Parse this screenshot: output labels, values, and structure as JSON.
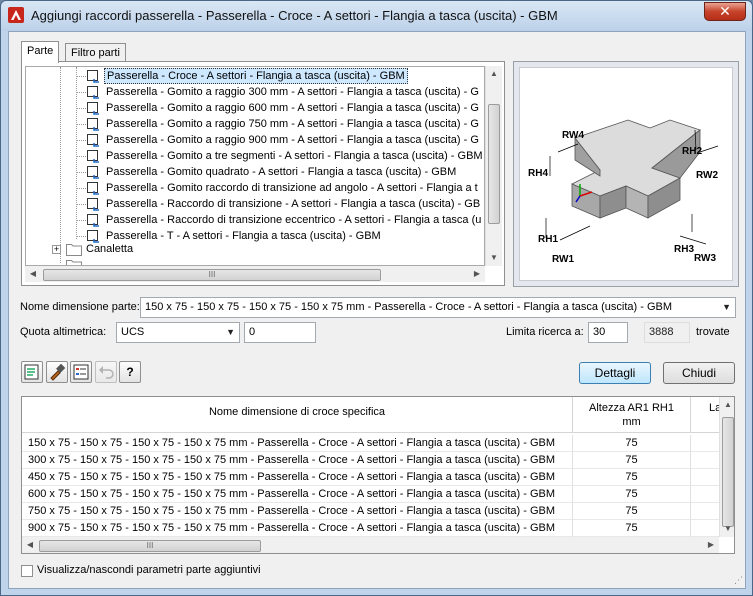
{
  "window": {
    "title": "Aggiungi raccordi passerella - Passerella - Croce - A settori - Flangia a tasca (uscita) - GBM",
    "close_label": "✕"
  },
  "tabs": [
    "Parte",
    "Filtro parti"
  ],
  "tree": {
    "items": [
      {
        "label": "Passerella - Croce - A settori - Flangia a tasca (uscita) - GBM",
        "selected": true
      },
      {
        "label": "Passerella - Gomito a raggio 300 mm - A settori - Flangia a tasca (uscita) - G"
      },
      {
        "label": "Passerella - Gomito a raggio 600 mm - A settori - Flangia a tasca (uscita) - G"
      },
      {
        "label": "Passerella - Gomito a raggio 750 mm - A settori - Flangia a tasca (uscita) - G"
      },
      {
        "label": "Passerella - Gomito a raggio 900 mm - A settori - Flangia a tasca (uscita) - G"
      },
      {
        "label": "Passerella - Gomito a tre segmenti - A settori - Flangia a tasca (uscita) - GBM"
      },
      {
        "label": "Passerella - Gomito quadrato - A settori - Flangia a tasca (uscita) - GBM"
      },
      {
        "label": "Passerella - Gomito raccordo di transizione ad angolo - A settori - Flangia a t"
      },
      {
        "label": "Passerella - Raccordo di transizione - A settori - Flangia a tasca (uscita) - GB"
      },
      {
        "label": "Passerella - Raccordo di transizione eccentrico - A settori - Flangia a tasca (u"
      },
      {
        "label": "Passerella - T - A settori - Flangia a tasca (uscita) - GBM"
      }
    ],
    "folder_label": "Canaletta",
    "hscroll_grip": "III"
  },
  "preview": {
    "labels": [
      "RW4",
      "RH4",
      "RH2",
      "RW2",
      "RH1",
      "RW1",
      "RH3",
      "RW3"
    ]
  },
  "form": {
    "size_name_label": "Nome dimensione parte:",
    "size_name_value": "150 x 75 - 150 x 75 - 150 x 75 - 150 x 75 mm - Passerella - Croce - A settori - Flangia a tasca (uscita) - GBM",
    "elevation_label": "Quota altimetrica:",
    "elevation_combo": "UCS",
    "elevation_value": "0",
    "limit_label": "Limita ricerca a:",
    "limit_value": "30",
    "found_count": "3888",
    "found_label": "trovate"
  },
  "toolbar": {
    "dettagli_label": "Dettagli",
    "chiudi_label": "Chiudi",
    "help_label": "?"
  },
  "grid": {
    "headers": [
      "Nome dimensione di croce specifica",
      "Altezza AR1 RH1\nmm",
      "La"
    ],
    "rows": [
      [
        "150 x 75 - 150 x 75 - 150 x 75 - 150 x 75 mm - Passerella - Croce - A settori - Flangia a tasca (uscita) - GBM",
        "75"
      ],
      [
        "300 x 75 - 150 x 75 - 150 x 75 - 150 x 75 mm - Passerella - Croce - A settori - Flangia a tasca (uscita) - GBM",
        "75"
      ],
      [
        "450 x 75 - 150 x 75 - 150 x 75 - 150 x 75 mm - Passerella - Croce - A settori - Flangia a tasca (uscita) - GBM",
        "75"
      ],
      [
        "600 x 75 - 150 x 75 - 150 x 75 - 150 x 75 mm - Passerella - Croce - A settori - Flangia a tasca (uscita) - GBM",
        "75"
      ],
      [
        "750 x 75 - 150 x 75 - 150 x 75 - 150 x 75 mm - Passerella - Croce - A settori - Flangia a tasca (uscita) - GBM",
        "75"
      ],
      [
        "900 x 75 - 150 x 75 - 150 x 75 - 150 x 75 mm - Passerella - Croce - A settori - Flangia a tasca (uscita) - GBM",
        "75"
      ]
    ],
    "hscroll_grip": "III"
  },
  "footer": {
    "checkbox_label": "Visualizza/nascondi parametri parte aggiuntivi",
    "grip": "⋰"
  }
}
